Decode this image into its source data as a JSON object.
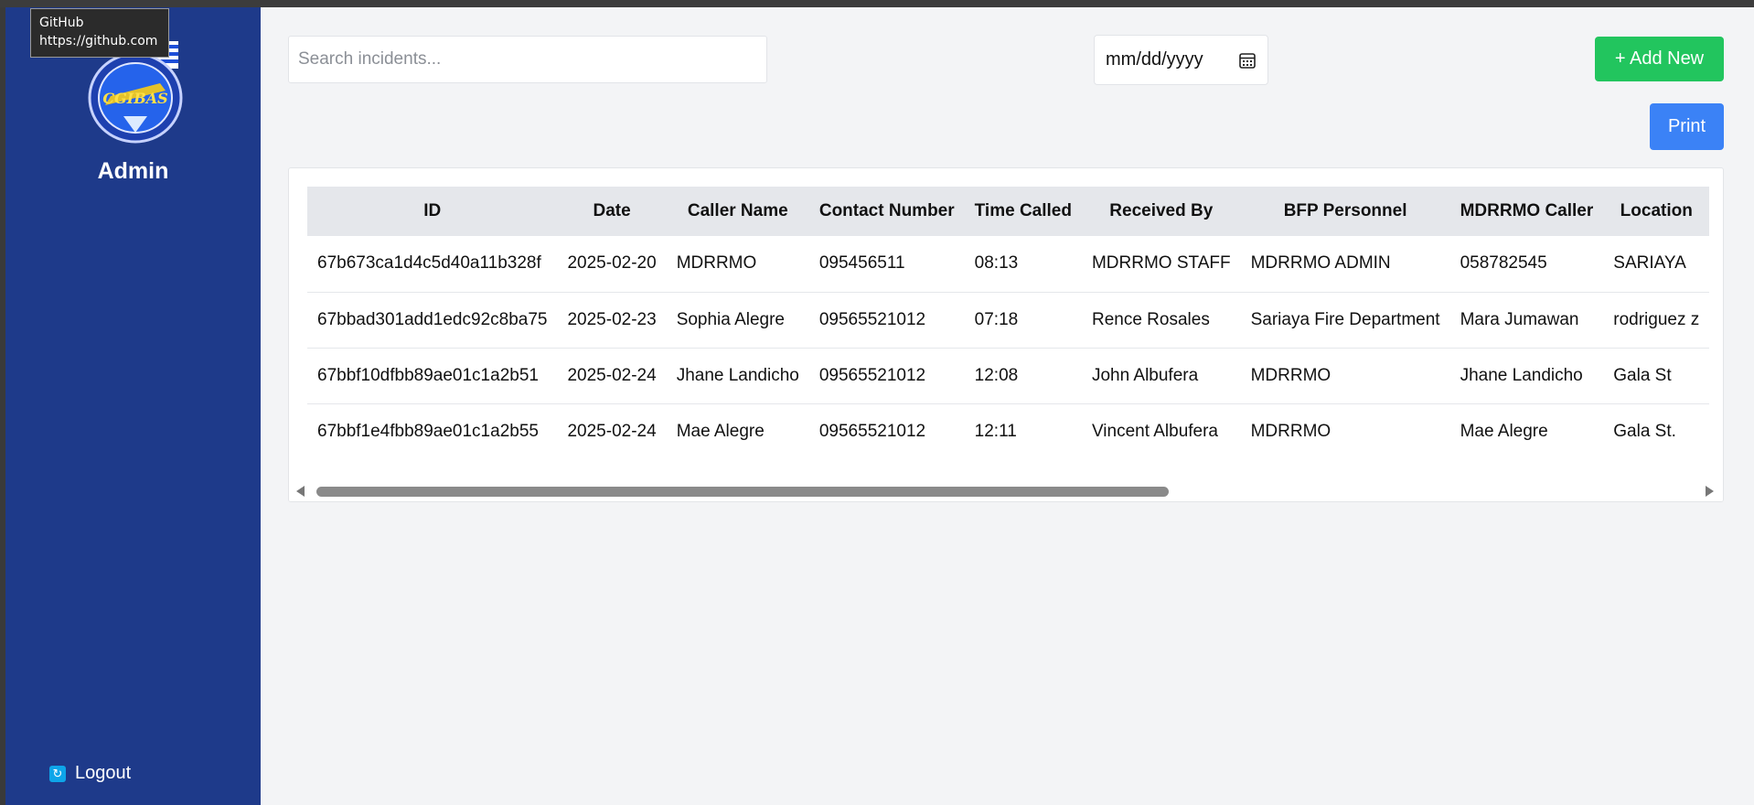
{
  "tooltip": {
    "title": "GitHub",
    "url": "https://github.com"
  },
  "sidebar": {
    "title": "Admin",
    "logout_label": "Logout",
    "logo_text": "CGIBAS"
  },
  "toolbar": {
    "search_placeholder": "Search incidents...",
    "date_placeholder": "mm/dd/yyyy",
    "add_label": "+ Add New",
    "print_label": "Print"
  },
  "colors": {
    "sidebar": "#1e3a8a",
    "add_button": "#22c55e",
    "print_button": "#3b82f6",
    "page_bg": "#f3f4f6"
  },
  "table": {
    "headers": [
      "ID",
      "Date",
      "Caller Name",
      "Contact Number",
      "Time Called",
      "Received By",
      "BFP Personnel",
      "MDRRMO Caller",
      "Location"
    ],
    "rows": [
      [
        "67b673ca1d4c5d40a11b328f",
        "2025-02-20",
        "MDRRMO",
        "095456511",
        "08:13",
        "MDRRMO STAFF",
        "MDRRMO ADMIN",
        "058782545",
        "SARIAYA"
      ],
      [
        "67bbad301add1edc92c8ba75",
        "2025-02-23",
        "Sophia Alegre",
        "09565521012",
        "07:18",
        "Rence Rosales",
        "Sariaya Fire Department",
        "Mara Jumawan",
        "rodriguez z"
      ],
      [
        "67bbf10dfbb89ae01c1a2b51",
        "2025-02-24",
        "Jhane Landicho",
        "09565521012",
        "12:08",
        "John Albufera",
        "MDRRMO",
        "Jhane Landicho",
        "Gala St"
      ],
      [
        "67bbf1e4fbb89ae01c1a2b55",
        "2025-02-24",
        "Mae Alegre",
        "09565521012",
        "12:11",
        "Vincent Albufera",
        "MDRRMO",
        "Mae Alegre",
        "Gala St."
      ]
    ]
  }
}
